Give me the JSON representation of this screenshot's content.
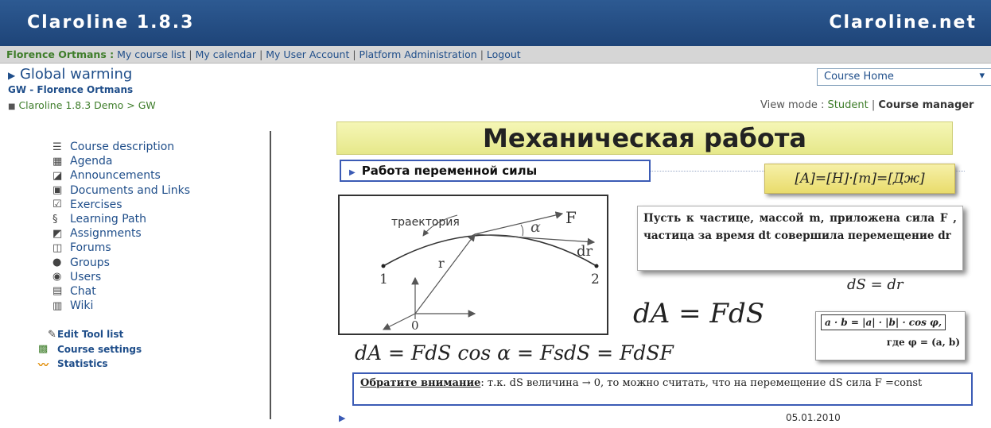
{
  "header": {
    "brand": "Claroline 1.8.3",
    "site": "Claroline.net"
  },
  "userbar": {
    "user_name": "Florence Ortmans :",
    "links": [
      "My course list",
      "My calendar",
      "My User Account",
      "Platform Administration",
      "Logout"
    ]
  },
  "course": {
    "title": "Global warming",
    "subtitle": "GW - Florence Ortmans",
    "breadcrumb": [
      "Claroline 1.8.3 Demo",
      "GW"
    ]
  },
  "course_select": {
    "value": "Course Home"
  },
  "view_mode": {
    "label": "View mode :",
    "student": "Student",
    "separator": "|",
    "manager": "Course manager"
  },
  "tools": [
    {
      "label": "Course description",
      "icon": "list-icon"
    },
    {
      "label": "Agenda",
      "icon": "calendar-icon"
    },
    {
      "label": "Announcements",
      "icon": "announcement-icon"
    },
    {
      "label": "Documents and Links",
      "icon": "folder-icon"
    },
    {
      "label": "Exercises",
      "icon": "checkbox-icon"
    },
    {
      "label": "Learning Path",
      "icon": "path-icon"
    },
    {
      "label": "Assignments",
      "icon": "assignment-icon"
    },
    {
      "label": "Forums",
      "icon": "forum-icon"
    },
    {
      "label": "Groups",
      "icon": "groups-icon"
    },
    {
      "label": "Users",
      "icon": "users-icon"
    },
    {
      "label": "Chat",
      "icon": "chat-icon"
    },
    {
      "label": "Wiki",
      "icon": "wiki-icon"
    }
  ],
  "management": [
    {
      "label": "Edit Tool list",
      "icon": "pencil-icon"
    },
    {
      "label": "Course settings",
      "icon": "settings-icon"
    },
    {
      "label": "Statistics",
      "icon": "statistics-icon"
    }
  ],
  "slide": {
    "title": "Механическая работа",
    "subtitle": "Работа переменной силы",
    "units": "[A]=[H]·[m]=[Дж]",
    "diagram": {
      "trajectory": "траектория",
      "alpha": "α",
      "F": "F",
      "dr": "dr",
      "r": "r",
      "p1": "1",
      "p2": "2",
      "origin": "0"
    },
    "text": "Пусть к частице, массой m, приложена сила F , частица за время dt совершила перемещение dr",
    "eq_ds": "dS = dr",
    "eq_da": "dA = FdS",
    "dot_line1": "a · b = |a| · |b| · cos φ,",
    "dot_line2": "где φ = (a, b)",
    "eq_main": "dA = FdS cos α = FsdS = FdSF",
    "note_label": "Обратите внимание",
    "note_text": ": т.к. dS величина → 0, то можно считать, что на перемещение dS сила  F =const",
    "date": "05.01.2010"
  }
}
